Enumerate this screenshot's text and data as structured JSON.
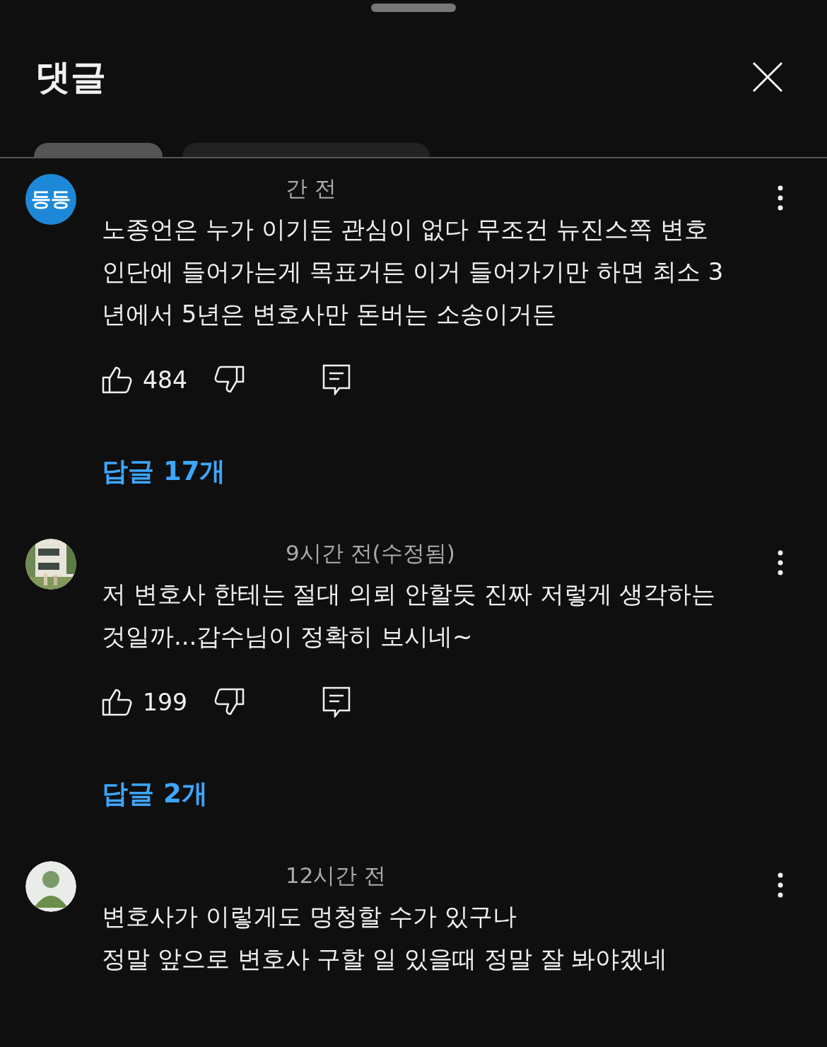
{
  "header": {
    "title": "댓글"
  },
  "filter_chips": [
    {
      "selected": true
    },
    {
      "selected": false
    }
  ],
  "comments": [
    {
      "avatar": {
        "kind": "initials",
        "text": "등등"
      },
      "time": "간 전",
      "text": "노종언은 누가 이기든 관심이 없다 무조건 뉴진스쪽 변호\n인단에 들어가는게 목표거든 이거 들어가기만 하면 최소 3\n년에서 5년은 변호사만 돈버는 소송이거든",
      "likes": "484",
      "replies": "답글 17개"
    },
    {
      "time": "9시간 전(수정됨)",
      "text": "저 변호사 한테는 절대 의뢰 안할듯 진짜 저렇게 생각하는\n것일까...갑수님이 정확히 보시네~",
      "likes": "199",
      "replies": "답글 2개"
    },
    {
      "avatar": {
        "kind": "figure"
      },
      "time": "12시간 전",
      "text": "변호사가 이렇게도 멍청할 수가 있구나\n정말 앞으로 변호사 구할 일 있을때 정말 잘 봐야겠네"
    }
  ]
}
